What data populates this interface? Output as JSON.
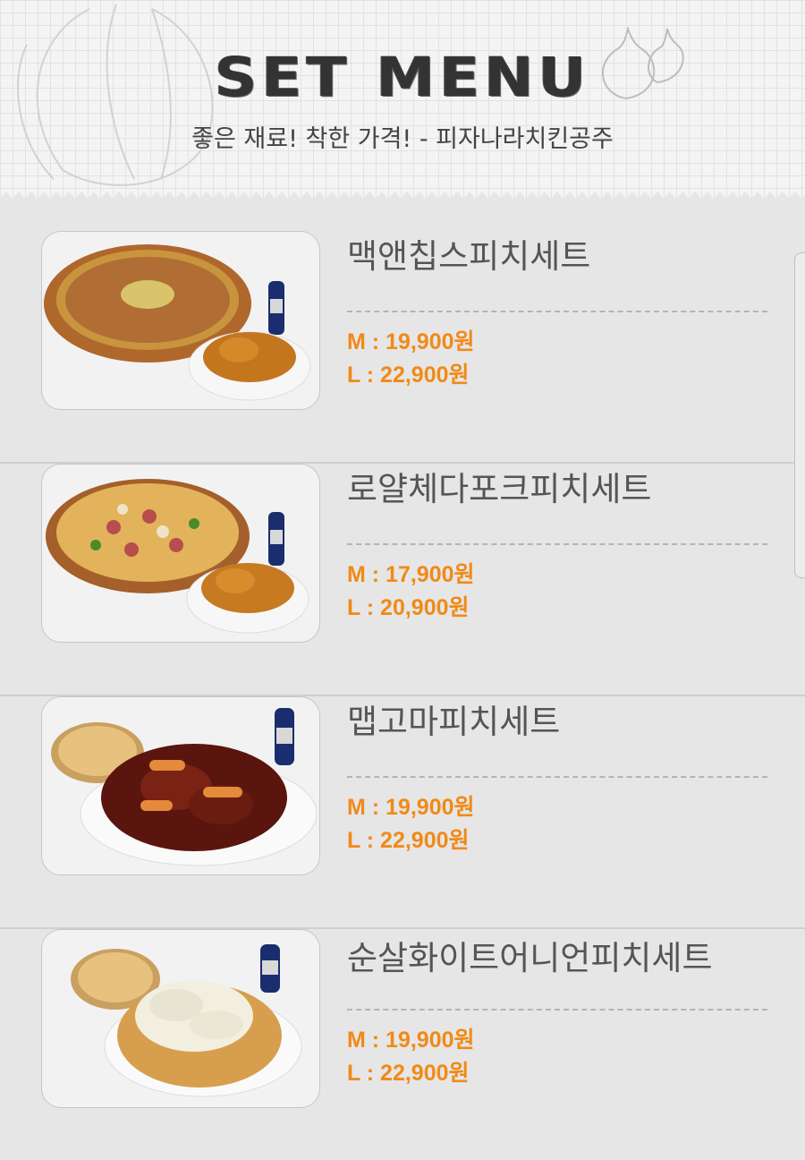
{
  "header": {
    "title": "SET MENU",
    "subtitle": "좋은 재료! 착한 가격! - 피자나라치킨공주"
  },
  "items": [
    {
      "name": "맥앤칩스피치세트",
      "price_m": "M : 19,900원",
      "price_l": "L : 22,900원",
      "image": "pizza-chicken-cola-photo"
    },
    {
      "name": "로얄체다포크피치세트",
      "price_m": "M : 17,900원",
      "price_l": "L : 20,900원",
      "image": "pizza-chicken-cola-photo"
    },
    {
      "name": "맵고마피치세트",
      "price_m": "M : 19,900원",
      "price_l": "L : 22,900원",
      "image": "spicy-chicken-pizza-cola-photo"
    },
    {
      "name": "순살화이트어니언피치세트",
      "price_m": "M : 19,900원",
      "price_l": "L : 22,900원",
      "image": "onion-chicken-pizza-cola-photo"
    }
  ],
  "colors": {
    "price": "#f08a18",
    "name": "#555555",
    "background": "#e6e6e6"
  }
}
